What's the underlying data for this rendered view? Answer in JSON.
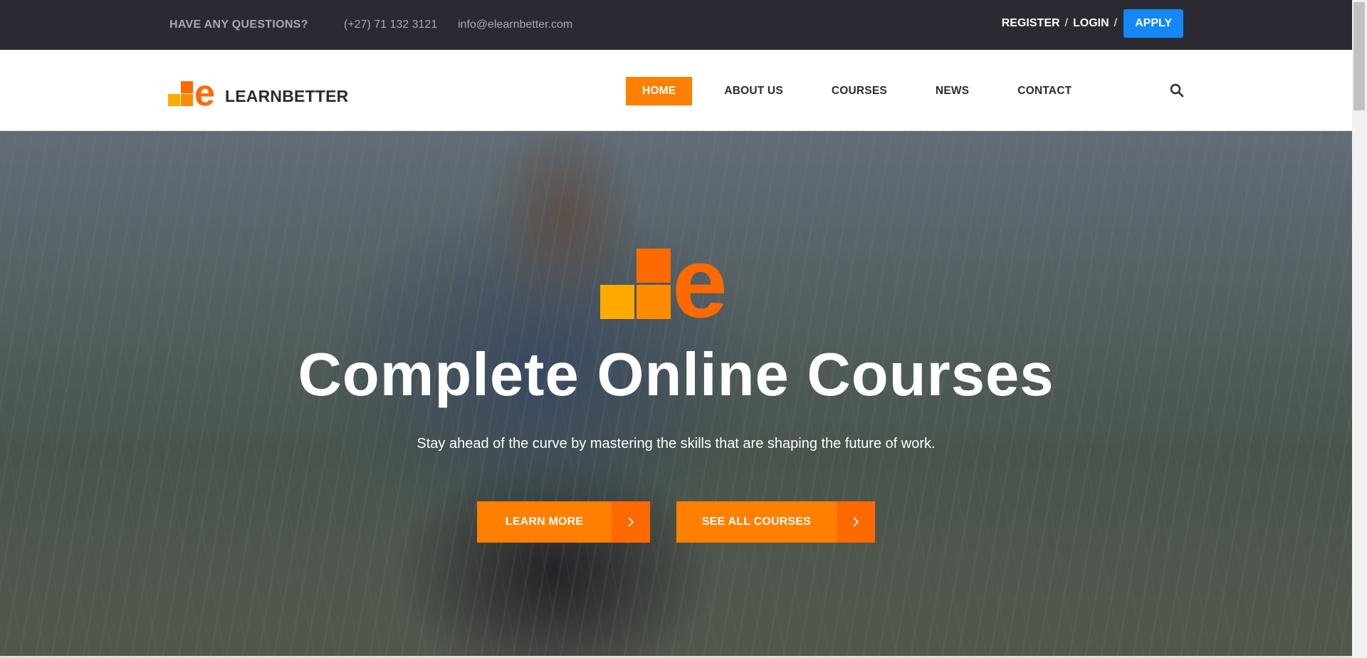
{
  "topbar": {
    "questions": "HAVE ANY QUESTIONS?",
    "phone": "(+27) 71 132 3121",
    "email": "info@elearnbetter.com",
    "register": "REGISTER",
    "separator": "/",
    "login": "LOGIN",
    "apply": "APPLY"
  },
  "header": {
    "logo_text": "LEARNBETTER",
    "nav": [
      {
        "label": "HOME",
        "active": true
      },
      {
        "label": "ABOUT US",
        "active": false
      },
      {
        "label": "COURSES",
        "active": false
      },
      {
        "label": "NEWS",
        "active": false
      },
      {
        "label": "CONTACT",
        "active": false
      }
    ],
    "search_icon": "search-icon"
  },
  "hero": {
    "title": "Complete Online Courses",
    "subtitle": "Stay ahead of the curve by mastering the skills that are shaping the future of work.",
    "buttons": [
      {
        "label": "LEARN MORE",
        "icon": "chevron-right-icon"
      },
      {
        "label": "SEE ALL COURSES",
        "icon": "chevron-right-icon"
      }
    ]
  },
  "colors": {
    "topbar_bg": "#2b2a33",
    "accent_orange": "#ff7f00",
    "arrow_orange": "#ff6a00",
    "logo_yellow": "#ffaa00",
    "apply_blue": "#1587f7"
  }
}
